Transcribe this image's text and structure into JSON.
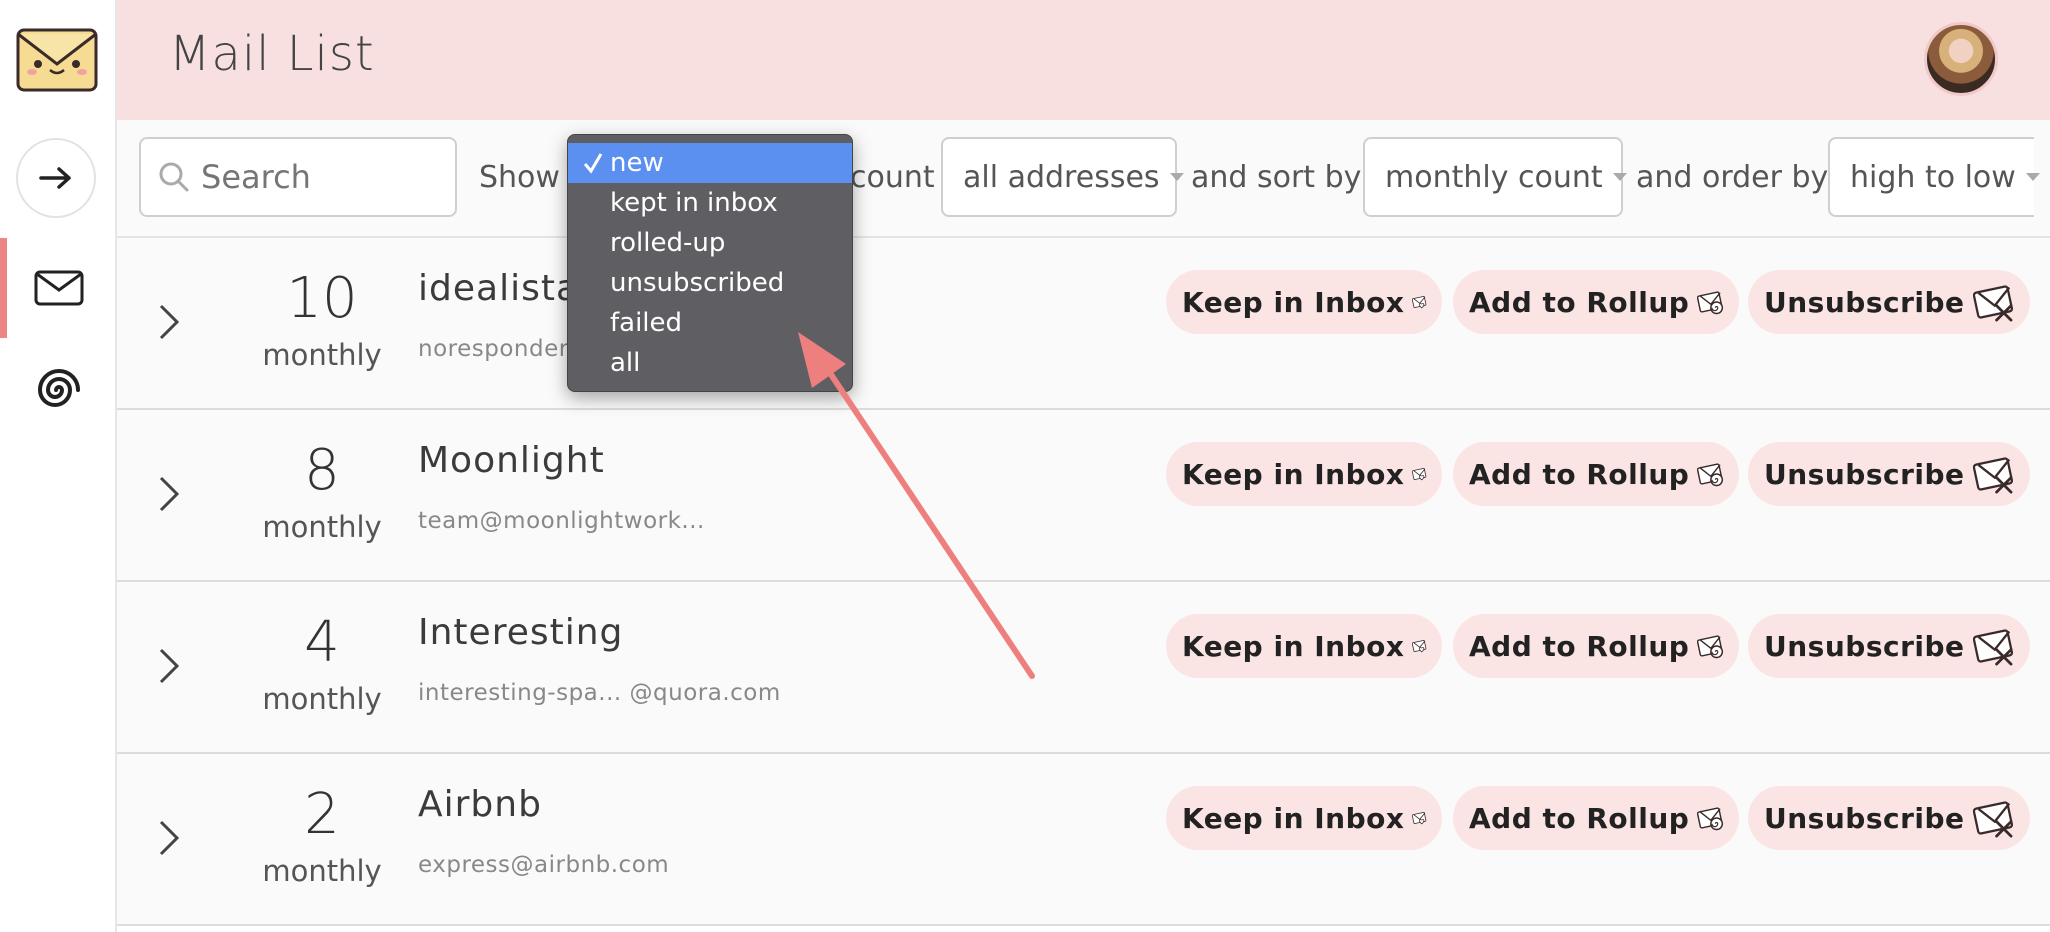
{
  "app": {
    "title": "Mail List"
  },
  "sidebar": {
    "logo": "envelope-face-logo",
    "items": [
      {
        "icon": "arrow-right-icon"
      },
      {
        "icon": "mail-icon",
        "active": true
      },
      {
        "icon": "spiral-icon"
      }
    ]
  },
  "filters": {
    "search_placeholder": "Search",
    "show_label": "Show",
    "count_label": "count",
    "address_value": "all addresses",
    "sort_label": "and sort by",
    "sort_value": "monthly count",
    "order_label": "and order by",
    "order_value": "high to low",
    "show_options": [
      "new",
      "kept in inbox",
      "rolled-up",
      "unsubscribed",
      "failed",
      "all"
    ],
    "show_selected": "new"
  },
  "actions": {
    "keep": "Keep in Inbox",
    "rollup": "Add to Rollup",
    "unsubscribe": "Unsubscribe"
  },
  "rows": [
    {
      "count": "10",
      "period": "monthly",
      "name": "idealista",
      "email": "noresponder"
    },
    {
      "count": "8",
      "period": "monthly",
      "name": "Moonlight",
      "email": "team@moonlightwork..."
    },
    {
      "count": "4",
      "period": "monthly",
      "name": "Interesting",
      "email": "interesting-spa... @quora.com"
    },
    {
      "count": "2",
      "period": "monthly",
      "name": "Airbnb",
      "email": "express@airbnb.com"
    }
  ],
  "colors": {
    "header_bg": "#f9e0e0",
    "accent": "#ee8585",
    "action_bg": "#fbe4e4",
    "dropdown_bg": "#5f5f63",
    "dropdown_selected": "#5b8ff0"
  }
}
